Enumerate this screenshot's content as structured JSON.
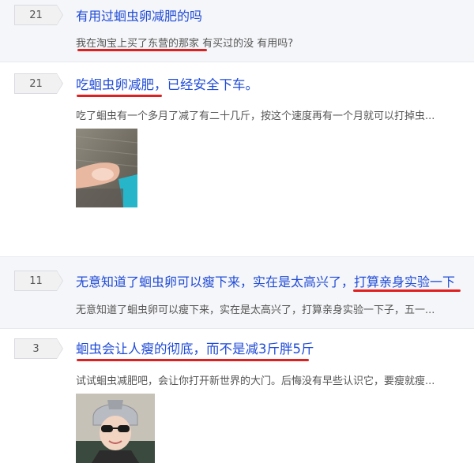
{
  "posts": [
    {
      "count": "21",
      "title": "有用过蛔虫卵减肥的吗",
      "snippet": "我在淘宝上买了东营的那家 有买过的没 有用吗?"
    },
    {
      "count": "21",
      "title": "吃蛔虫卵减肥，已经安全下车。",
      "snippet": "吃了蛔虫有一个多月了减了有二十几斤，按这个速度再有一个月就可以打掉虫..."
    },
    {
      "count": "11",
      "title": "无意知道了蛔虫卵可以瘦下来，实在是太高兴了，打算亲身实验一下",
      "snippet": "无意知道了蛔虫卵可以瘦下来，实在是太高兴了，打算亲身实验一下子，五一..."
    },
    {
      "count": "3",
      "title": "蛔虫会让人瘦的彻底，而不是减3斤胖5斤",
      "snippet": "试试蛔虫减肥吧，会让你打开新世界的大门。后悔没有早些认识它，要瘦就瘦..."
    }
  ],
  "colors": {
    "title_link": "#1f4bd8",
    "annotation_underline": "#e02020",
    "shaded_row": "#f5f6f9"
  }
}
